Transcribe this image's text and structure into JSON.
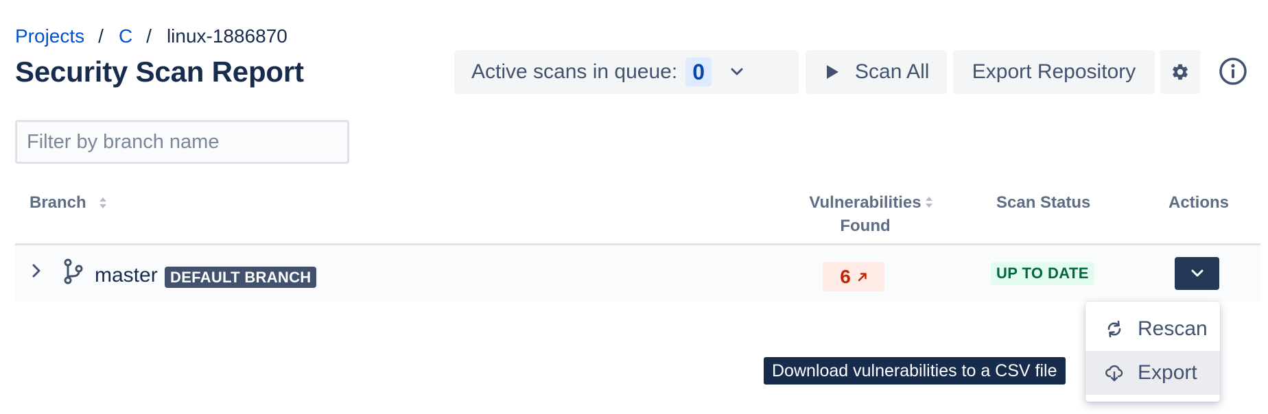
{
  "breadcrumb": {
    "items": [
      {
        "label": "Projects"
      },
      {
        "label": "C"
      },
      {
        "label": "linux-1886870"
      }
    ],
    "separator": "/"
  },
  "page": {
    "title": "Security Scan Report"
  },
  "toolbar": {
    "queue_label": "Active scans in queue:",
    "queue_count": "0",
    "scan_all_label": "Scan All",
    "export_repository_label": "Export Repository",
    "settings_icon": "gear-icon",
    "info_icon": "info-icon"
  },
  "filter": {
    "placeholder": "Filter by branch name",
    "value": ""
  },
  "table": {
    "headers": {
      "branch": "Branch",
      "vulnerabilities": "Vulnerabilities Found",
      "scan_status": "Scan Status",
      "actions": "Actions"
    },
    "rows": [
      {
        "branch": "master",
        "badge": "DEFAULT BRANCH",
        "vulnerabilities": "6",
        "scan_status": "UP TO DATE"
      }
    ]
  },
  "actions_menu": {
    "items": [
      {
        "label": "Rescan",
        "icon": "refresh-icon"
      },
      {
        "label": "Export",
        "icon": "cloud-download-icon"
      }
    ]
  },
  "tooltip": {
    "text": "Download vulnerabilities to a CSV file"
  },
  "colors": {
    "link": "#0052cc",
    "title": "#172b4d",
    "button_bg": "#f4f5f7",
    "vuln_bg": "#ffebe6",
    "vuln_text": "#bf2600",
    "status_bg": "#e3fcef",
    "status_text": "#006644",
    "badge_bg": "#42526e",
    "primary_dark": "#253858"
  }
}
